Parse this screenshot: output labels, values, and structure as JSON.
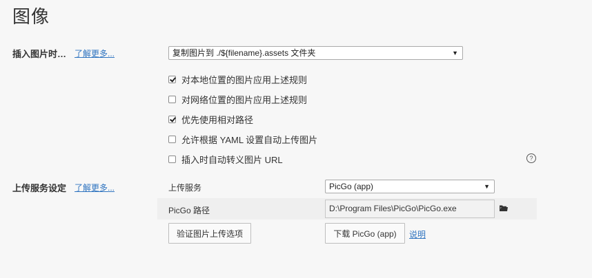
{
  "page": {
    "title": "图像"
  },
  "insert_image": {
    "label": "插入图片时…",
    "learn_more": "了解更多...",
    "select_value": "复制图片到 ./${filename}.assets 文件夹",
    "options": [
      {
        "label": "对本地位置的图片应用上述规则",
        "checked": true
      },
      {
        "label": "对网络位置的图片应用上述规则",
        "checked": false
      },
      {
        "label": "优先使用相对路径",
        "checked": true
      },
      {
        "label": "允许根据 YAML 设置自动上传图片",
        "checked": false
      },
      {
        "label": "插入时自动转义图片 URL",
        "checked": false
      }
    ]
  },
  "upload": {
    "label": "上传服务设定",
    "learn_more": "了解更多...",
    "service_label": "上传服务",
    "service_value": "PicGo (app)",
    "path_label": "PicGo 路径",
    "path_value": "D:\\Program Files\\PicGo\\PicGo.exe",
    "verify_button": "验证图片上传选项",
    "download_button": "下载 PicGo (app)",
    "explain_link": "说明"
  }
}
